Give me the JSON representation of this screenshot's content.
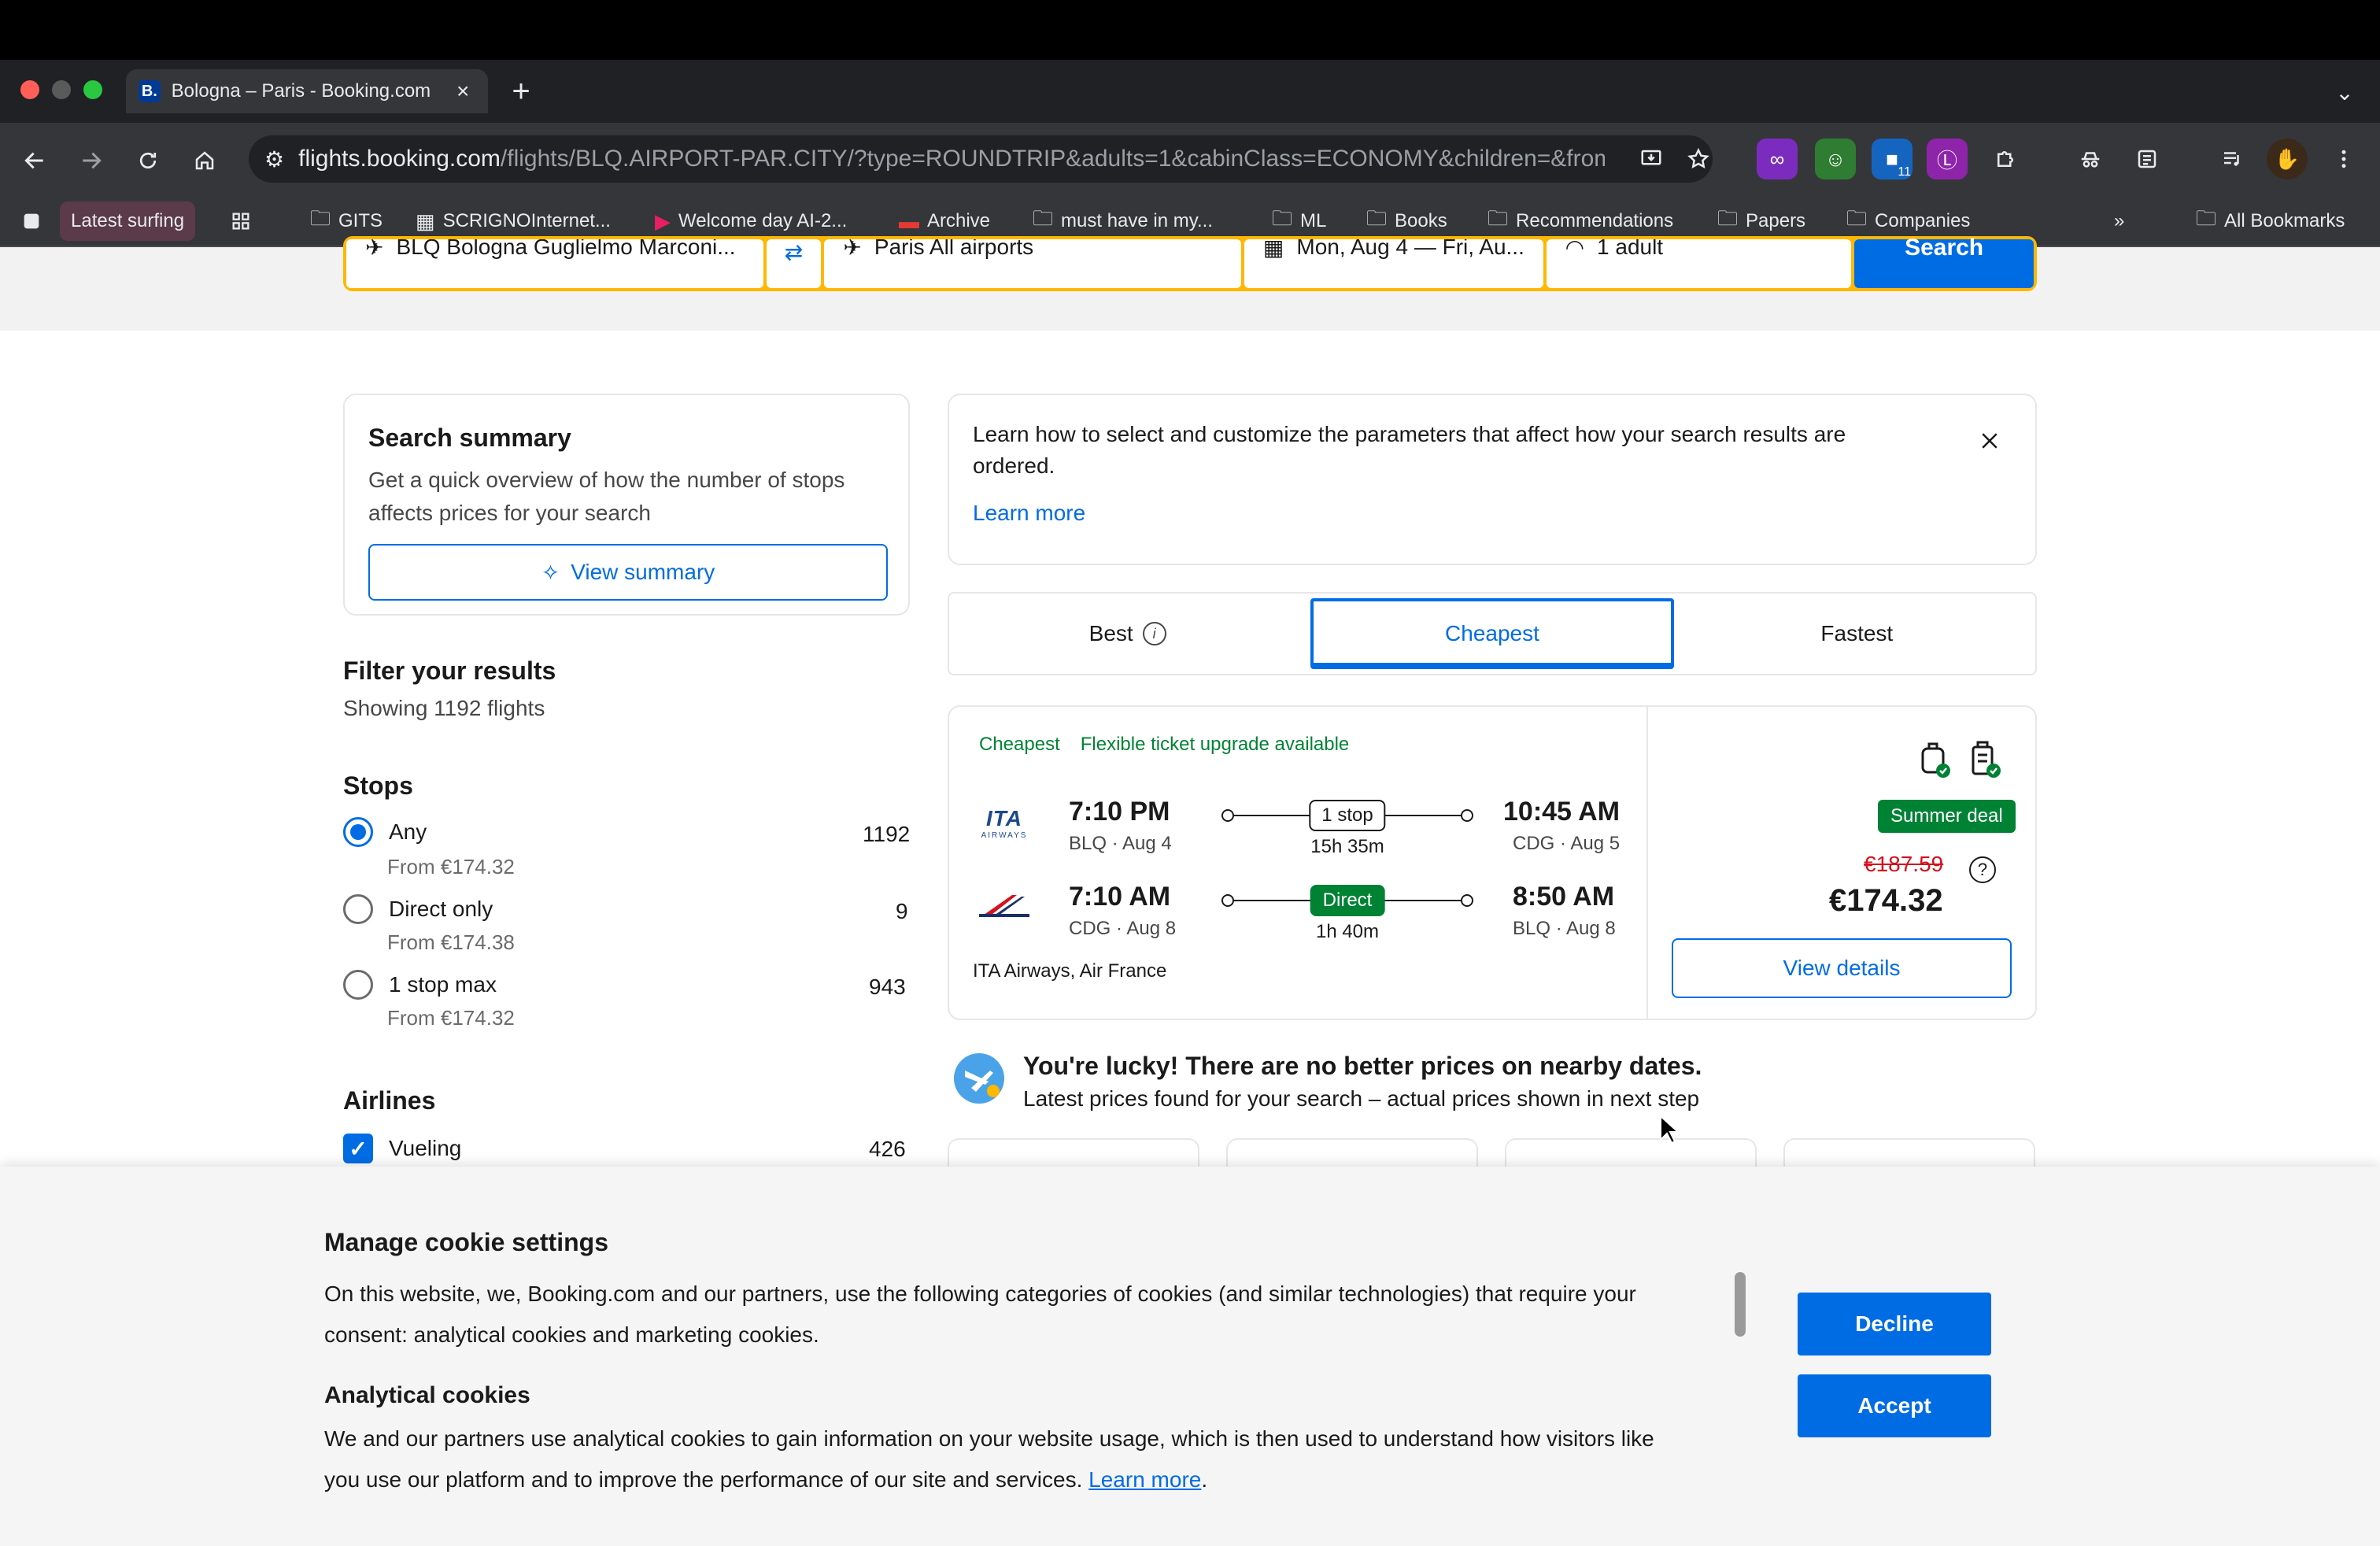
{
  "browser": {
    "tab": {
      "favicon": "B.",
      "title": "Bologna – Paris - Booking.com",
      "close": "×"
    },
    "new_tab": "+",
    "tab_search": "⌄",
    "omnibox": {
      "host": "flights.booking.com",
      "path": "/flights/BLQ.AIRPORT-PAR.CITY/?type=ROUNDTRIP&adults=1&cabinClass=ECONOMY&children=&from=..."
    },
    "bookmarks": [
      {
        "label": "Latest surfing"
      },
      {
        "label": "GITS"
      },
      {
        "label": "SCRIGNOInternet..."
      },
      {
        "label": "Welcome day AI-2..."
      },
      {
        "label": "Archive"
      },
      {
        "label": "must have in my..."
      },
      {
        "label": "ML"
      },
      {
        "label": "Books"
      },
      {
        "label": "Recommendations"
      },
      {
        "label": "Papers"
      },
      {
        "label": "Companies"
      },
      {
        "label": "All Bookmarks"
      }
    ],
    "overflow": "»",
    "ext_badge": "11"
  },
  "search": {
    "from": "BLQ Bologna Guglielmo Marconi...",
    "to": "Paris All airports",
    "dates": "Mon, Aug 4 — Fri, Au...",
    "travellers": "1 adult",
    "button": "Search"
  },
  "summary": {
    "title": "Search summary",
    "desc_line1": "Get a quick overview of how the number of stops",
    "desc_line2": "affects prices for your search",
    "button": "View summary"
  },
  "filters": {
    "title": "Filter your results",
    "count": "Showing 1192 flights",
    "stops_title": "Stops",
    "stops": [
      {
        "label": "Any",
        "from": "From €174.32",
        "count": "1192"
      },
      {
        "label": "Direct only",
        "from": "From €174.38",
        "count": "9"
      },
      {
        "label": "1 stop max",
        "from": "From €174.32",
        "count": "943"
      }
    ],
    "airlines_title": "Airlines",
    "airlines": [
      {
        "label": "Vueling",
        "count": "426"
      }
    ]
  },
  "info": {
    "text_line1": "Learn how to select and customize the parameters that affect how your search results are",
    "text_line2": "ordered.",
    "link": "Learn more"
  },
  "sort": {
    "tabs": [
      "Best",
      "Cheapest",
      "Fastest"
    ],
    "active": "Cheapest"
  },
  "flight": {
    "badges": [
      "Cheapest",
      "Flexible ticket upgrade available"
    ],
    "outbound": {
      "dep_time": "7:10 PM",
      "dep_info": "BLQ · Aug 4",
      "stops": "1 stop",
      "duration": "15h 35m",
      "arr_time": "10:45 AM",
      "arr_info": "CDG · Aug 5"
    },
    "inbound": {
      "dep_time": "7:10 AM",
      "dep_info": "CDG · Aug 8",
      "stops": "Direct",
      "duration": "1h 40m",
      "arr_time": "8:50 AM",
      "arr_info": "BLQ · Aug 8"
    },
    "carriers": "ITA Airways, Air France",
    "logo_ita": "ITA",
    "logo_ita_sub": "AIRWAYS",
    "deal": "Summer deal",
    "old_price": "€187.59",
    "price": "€174.32",
    "details_button": "View details"
  },
  "lucky": {
    "title": "You're lucky! There are no better prices on nearby dates.",
    "subtitle": "Latest prices found for your search – actual prices shown in next step"
  },
  "cookie": {
    "title": "Manage cookie settings",
    "text_line1": "On this website, we, Booking.com and our partners, use the following categories of cookies (and similar technologies) that require your",
    "text_line2": "consent: analytical cookies and marketing cookies.",
    "analytical_title": "Analytical cookies",
    "analytical_line1": "We and our partners use analytical cookies to gain information on your website usage, which is then used to understand how visitors like",
    "analytical_line2": "you use our platform and to improve the performance of our site and services.",
    "learn_more": "Learn more",
    "decline": "Decline",
    "accept": "Accept"
  },
  "colors": {
    "brand_blue": "#006ce4",
    "search_yellow": "#ffb700",
    "deal_green": "#008234",
    "strike_red": "#d4111e"
  }
}
